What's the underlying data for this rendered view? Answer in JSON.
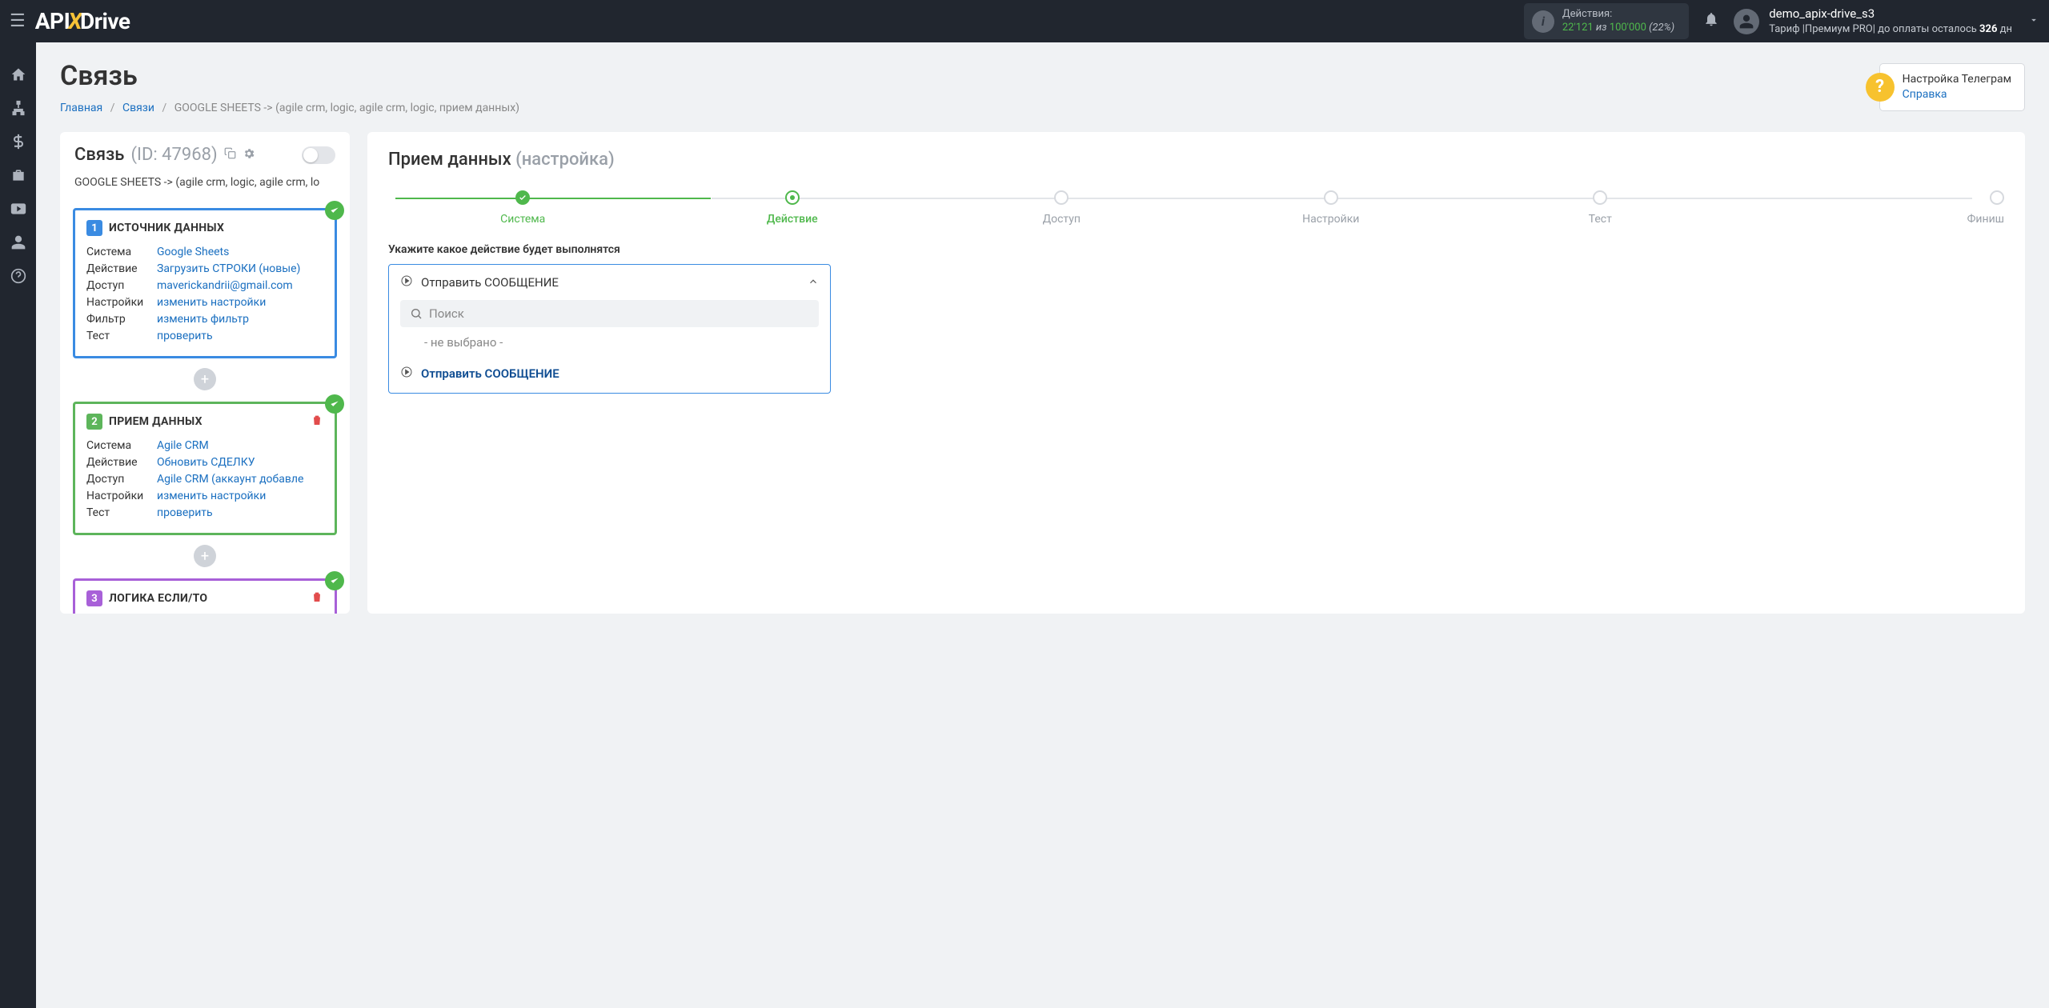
{
  "topbar": {
    "actions_label": "Действия:",
    "actions_used": "22'121",
    "actions_from": " из ",
    "actions_total": "100'000",
    "actions_pct": " (22%)",
    "username": "demo_apix-drive_s3",
    "tariff_prefix": "Тариф |Премиум PRO| до оплаты осталось ",
    "tariff_days": "326",
    "tariff_suffix": " дн"
  },
  "page": {
    "title": "Связь",
    "crumb_home": "Главная",
    "crumb_links": "Связи",
    "crumb_current": "GOOGLE SHEETS -> (agile crm, logic, agile crm, logic, прием данных)"
  },
  "help": {
    "line1": "Настройка Телеграм",
    "line2": "Справка"
  },
  "conn": {
    "title": "Связь",
    "id": "(ID: 47968)",
    "subtitle": "GOOGLE SHEETS -> (agile crm, logic, agile crm, lo"
  },
  "block1": {
    "title": "ИСТОЧНИК ДАННЫХ",
    "rows": {
      "sys_k": "Система",
      "sys_v": "Google Sheets",
      "act_k": "Действие",
      "act_v": "Загрузить СТРОКИ (новые)",
      "acc_k": "Доступ",
      "acc_v": "maverickandrii@gmail.com",
      "set_k": "Настройки",
      "set_v": "изменить настройки",
      "flt_k": "Фильтр",
      "flt_v": "изменить фильтр",
      "tst_k": "Тест",
      "tst_v": "проверить"
    }
  },
  "block2": {
    "title": "ПРИЕМ ДАННЫХ",
    "rows": {
      "sys_k": "Система",
      "sys_v": "Agile CRM",
      "act_k": "Действие",
      "act_v": "Обновить СДЕЛКУ",
      "acc_k": "Доступ",
      "acc_v": "Agile CRM (аккаунт добавле",
      "set_k": "Настройки",
      "set_v": "изменить настройки",
      "tst_k": "Тест",
      "tst_v": "проверить"
    }
  },
  "block3": {
    "title": "ЛОГИКА ЕСЛИ/ТО"
  },
  "right": {
    "heading_main": "Прием данных",
    "heading_sub": " (настройка)",
    "steps": [
      "Система",
      "Действие",
      "Доступ",
      "Настройки",
      "Тест",
      "Финиш"
    ],
    "prompt": "Укажите какое действие будет выполнятся",
    "selected": "Отправить СООБЩЕНИЕ",
    "search_ph": "Поиск",
    "opt_none": "- не выбрано -",
    "opt1": "Отправить СООБЩЕНИЕ"
  }
}
